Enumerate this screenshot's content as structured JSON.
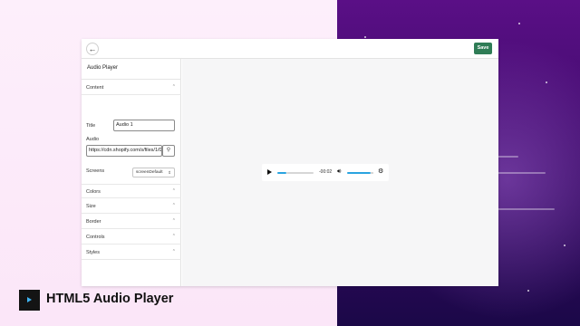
{
  "topbar": {
    "back_icon": "arrow-left-icon",
    "save_label": "Save",
    "save_color": "#2f7d56"
  },
  "sidebar": {
    "title": "Audio Player",
    "content_section": "Content",
    "fields": {
      "title_label": "Title",
      "title_value": "Audio 1",
      "audio_label": "Audio",
      "audio_value": "https://cdn.shopify.com/s/files/1/0...",
      "screens_label": "Screens",
      "screens_value": "screenDefault"
    },
    "sections": [
      "Colors",
      "Size",
      "Border",
      "Controls",
      "Styles"
    ]
  },
  "player": {
    "time": "-00:02",
    "progress": 0.25,
    "volume": 0.9,
    "accent": "#2aa4e0"
  },
  "caption": {
    "text": "HTML5 Audio Player",
    "accent": "#3fb3f0"
  }
}
